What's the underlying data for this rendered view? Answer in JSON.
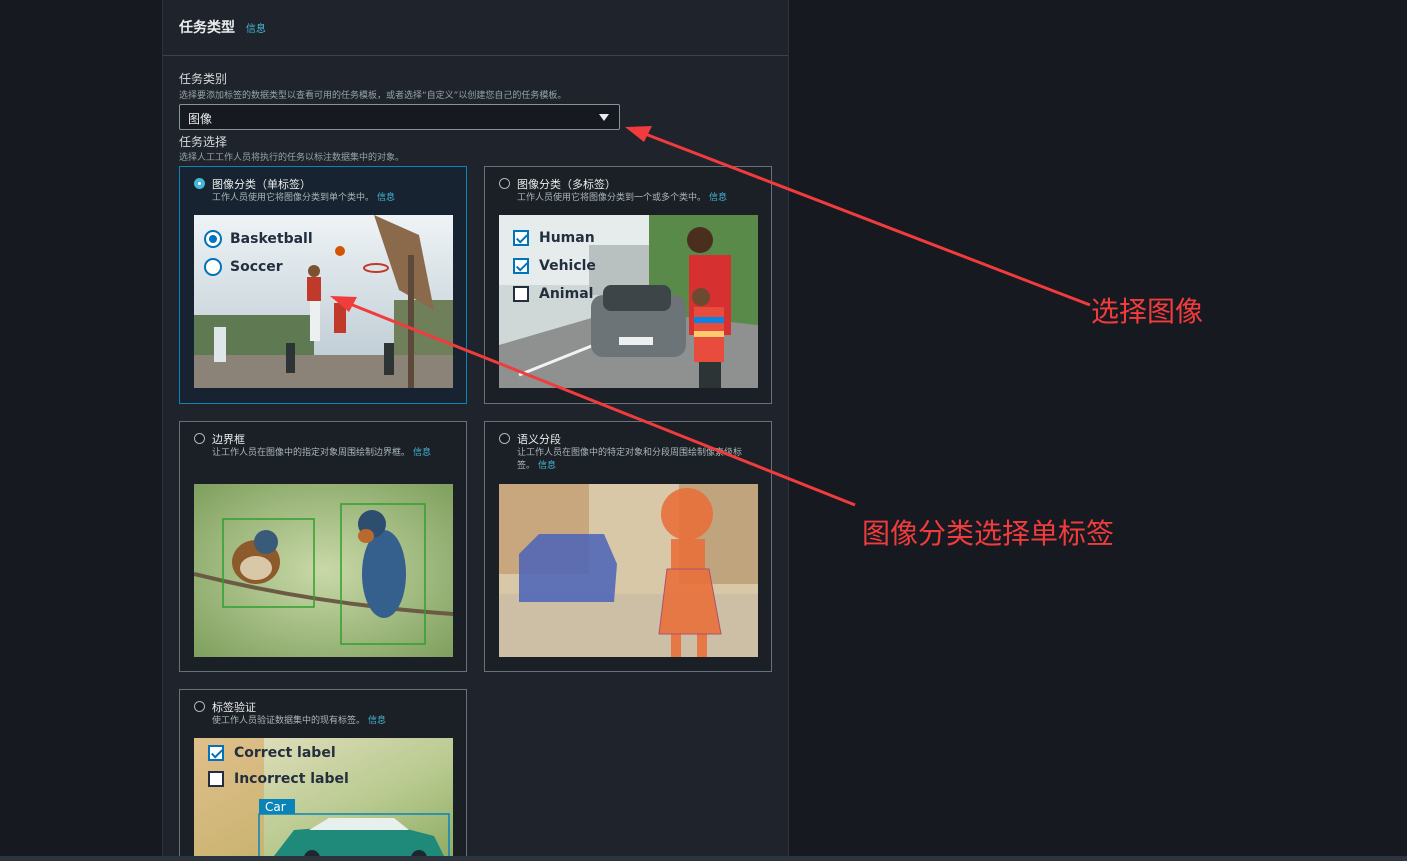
{
  "section": {
    "title": "任务类型",
    "info": "信息"
  },
  "category": {
    "label": "任务类别",
    "description": "选择要添加标签的数据类型以查看可用的任务模板，或者选择“自定义”以创建您自己的任务模板。",
    "selected": "图像"
  },
  "selection": {
    "label": "任务选择",
    "description": "选择人工工作人员将执行的任务以标注数据集中的对象。"
  },
  "cards": [
    {
      "title": "图像分类（单标签）",
      "description": "工作人员使用它将图像分类到单个类中。",
      "info": "信息",
      "selected": true,
      "options": [
        "Basketball",
        "Soccer"
      ]
    },
    {
      "title": "图像分类（多标签）",
      "description": "工作人员使用它将图像分类到一个或多个类中。",
      "info": "信息",
      "selected": false,
      "options": [
        "Human",
        "Vehicle",
        "Animal"
      ]
    },
    {
      "title": "边界框",
      "description": "让工作人员在图像中的指定对象周围绘制边界框。",
      "info": "信息",
      "selected": false
    },
    {
      "title": "语义分段",
      "description": "让工作人员在图像中的特定对象和分段周围绘制像素级标签。",
      "info": "信息",
      "selected": false
    },
    {
      "title": "标签验证",
      "description": "使工作人员验证数据集中的现有标签。",
      "info": "信息",
      "selected": false,
      "options": [
        "Correct label",
        "Incorrect label"
      ],
      "box_label": "Car"
    }
  ],
  "annotations": {
    "select_image": "选择图像",
    "select_single_label": "图像分类选择单标签"
  },
  "colors": {
    "accent": "#44b9d6",
    "annotation": "#f03c3c",
    "selected_border": "#0a84b8"
  }
}
